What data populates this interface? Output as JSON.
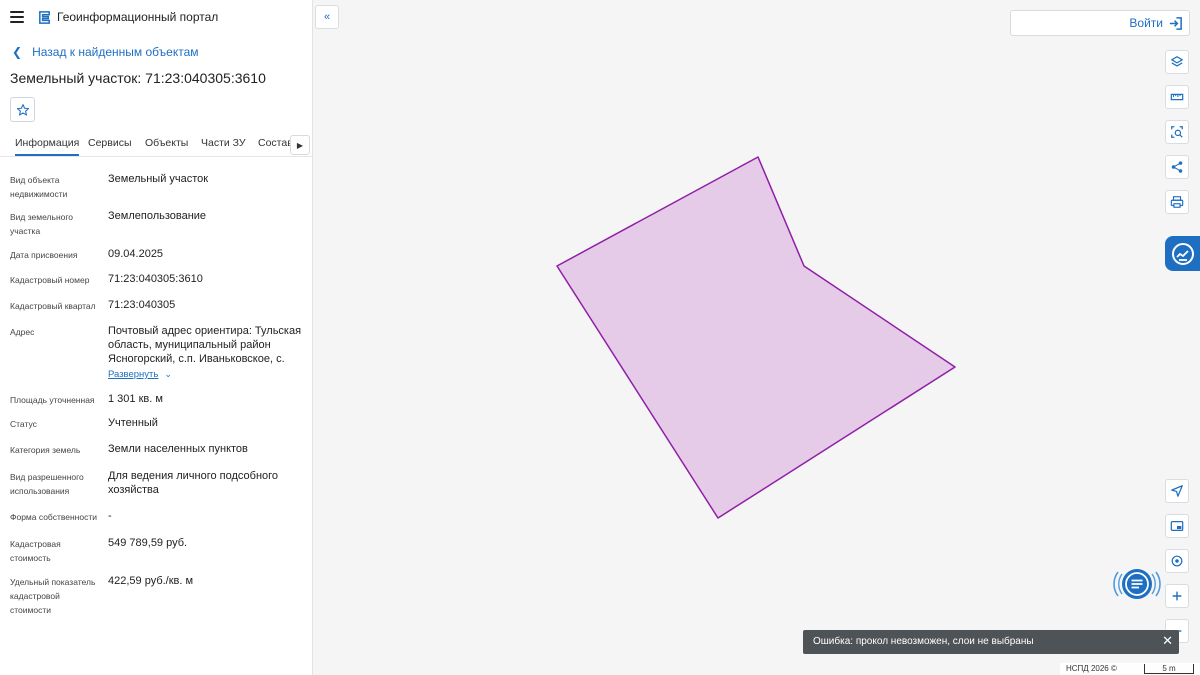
{
  "header": {
    "portal_title": "Геоинформационный портал",
    "menu_icon": "hamburger-icon",
    "logo_icon": "portal-logo-icon"
  },
  "panel": {
    "back_label": "Назад к найденным объектам",
    "object_title": "Земельный участок: 71:23:040305:3610",
    "tabs": [
      {
        "label": "Информация",
        "active": true
      },
      {
        "label": "Сервисы",
        "active": false
      },
      {
        "label": "Объекты",
        "active": false
      },
      {
        "label": "Части ЗУ",
        "active": false
      },
      {
        "label": "Состав",
        "active": false
      }
    ],
    "attributes": [
      {
        "label": "Вид объекта недвижимости",
        "value": "Земельный участок"
      },
      {
        "label": "Вид земельного участка",
        "value": "Землепользование"
      },
      {
        "label": "Дата присвоения",
        "value": "09.04.2025"
      },
      {
        "label": "Кадастровый номер",
        "value": "71:23:040305:3610"
      },
      {
        "label": "Кадастровый квартал",
        "value": "71:23:040305"
      },
      {
        "label": "Адрес",
        "value": "Почтовый адрес ориентира: Тульская область, муниципальный район Ясногорский, с.п. Иваньковское, с."
      },
      {
        "label": "Площадь уточненная",
        "value": "1 301 кв. м"
      },
      {
        "label": "Статус",
        "value": "Учтенный"
      },
      {
        "label": "Категория земель",
        "value": "Земли населенных пунктов"
      },
      {
        "label": "Вид разрешенного использования",
        "value": "Для ведения личного подсобного хозяйства"
      },
      {
        "label": "Форма собственности",
        "value": "-"
      },
      {
        "label": "Кадастровая стоимость",
        "value": "549 789,59 руб."
      },
      {
        "label": "Удельный показатель кадастровой стоимости",
        "value": "422,59 руб./кв. м"
      }
    ],
    "expand_label": "Развернуть"
  },
  "map": {
    "login_label": "Войти",
    "toast_text": "Ошибка: прокол невозможен, слои не выбраны",
    "attribution": "НСПД 2026 ©",
    "scale_label": "5 m",
    "parcel_fill": "#e6cbe8",
    "parcel_stroke": "#8e1fa6",
    "accent": "#1e6fc2"
  }
}
